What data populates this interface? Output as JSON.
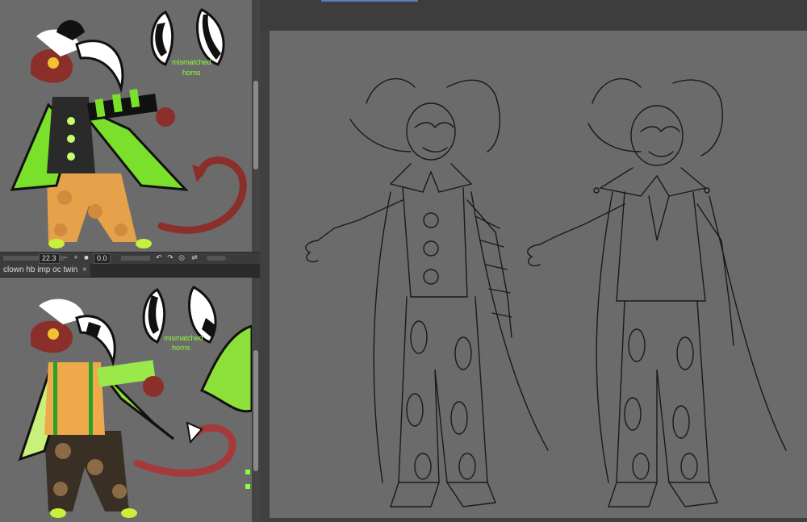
{
  "navigator": {
    "zoom_value": "22.3",
    "rotate_value": "0.0",
    "minus_icon": "minus-icon",
    "plus_icon": "plus-icon"
  },
  "document_tab": {
    "label": "clown hb imp oc twin",
    "close_glyph": "×"
  },
  "reference_top": {
    "note_line1": "mismatched",
    "note_line2": "horns"
  },
  "reference_bottom": {
    "note_line1": "mismatched",
    "note_line2": "horns"
  },
  "colors": {
    "accent_green": "#8cff3a",
    "panel_gray": "#6b6b6b",
    "skin_red": "#8b2f2a"
  }
}
